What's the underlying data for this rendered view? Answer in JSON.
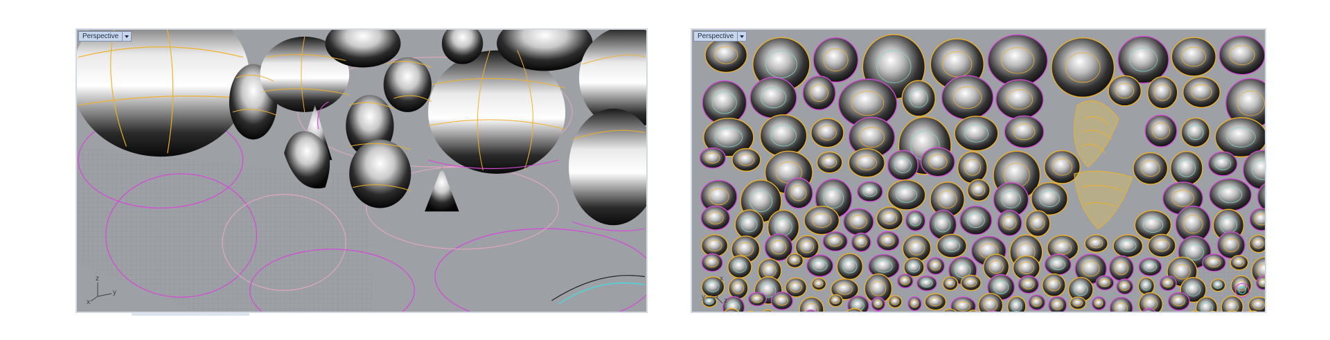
{
  "viewports": [
    {
      "title": "Perspective",
      "axes": {
        "x": "x",
        "y": "y",
        "z": "z"
      }
    },
    {
      "title": "Perspective",
      "axes": {
        "x": "x",
        "y": "y",
        "z": "z"
      }
    }
  ],
  "colors": {
    "viewport_bg": "#9da1a6",
    "viewport_border": "#d3d9e3",
    "isocurve": "#f0b12a",
    "magenta_curve": "#d44bd6",
    "pink_curve": "#e7a6c5",
    "grid": "#878c92"
  },
  "icons": {
    "viewport_menu": "chevron-down-icon",
    "axis_widget": "axis-icon"
  }
}
